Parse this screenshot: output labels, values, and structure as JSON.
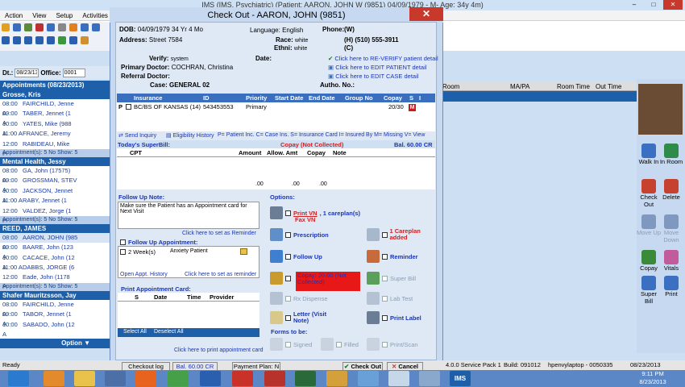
{
  "app": {
    "title": "IMS (IMS, Psychiatric)  (Patient: AARON, JOHN W (9851) 04/09/1979 - M- Age: 34y 4m)",
    "menu": [
      "Action",
      "View",
      "Setup",
      "Activities",
      "Bi"
    ],
    "window_controls": [
      "–",
      "□",
      "✕"
    ]
  },
  "left_panel": {
    "dt_label": "Dt.:",
    "date": "08/23/13",
    "office_label": "Office:",
    "office": "0001",
    "appointments_header": "Appointments (08/23/2013)",
    "providers": [
      {
        "name": "Grosse, Kris",
        "appointments": [
          {
            "time": "08:00 A",
            "patient": "FAIRCHILD, Jenne"
          },
          {
            "time": "09:00 A",
            "patient": "TABER, Jennet (1"
          },
          {
            "time": "10:00 A",
            "patient": "YATES, Mike (988"
          },
          {
            "time": "11:00 A",
            "patient": "FRANCE, Jeremy"
          },
          {
            "time": "12:00 P",
            "patient": "RABIDEAU, Mike"
          }
        ],
        "summary": "Appointment(s): 5  No Show: 5"
      },
      {
        "name": "Mental Health, Jessy",
        "appointments": [
          {
            "time": "08:00 A",
            "patient": "GA, John (17575)"
          },
          {
            "time": "09:00 A",
            "patient": "GROSSMAN, STEV"
          },
          {
            "time": "10:00 A",
            "patient": "JACKSON, Jennet"
          },
          {
            "time": "11:00 A",
            "patient": "RABY, Jennet (1"
          },
          {
            "time": "12:00 P",
            "patient": "VALDEZ, Jorge (1"
          }
        ],
        "summary": "Appointment(s): 5  No Show: 5"
      },
      {
        "name": "REED, JAMES",
        "appointments": [
          {
            "time": "08:00 A",
            "patient": "AARON, JOHN (985"
          },
          {
            "time": "09:00 A",
            "patient": "BAARE, John (123"
          },
          {
            "time": "10:00 A",
            "patient": "CACACE, John (12"
          },
          {
            "time": "11:00 A",
            "patient": "DABBS, JORGE (6"
          },
          {
            "time": "12:00 P",
            "patient": "Eade, John (1178"
          }
        ],
        "summary": "Appointment(s): 5  No Show: 5"
      },
      {
        "name": "Shafer Mauritzsson, Jay",
        "appointments": [
          {
            "time": "08:00 A",
            "patient": "FAIRCHILD, Jenne"
          },
          {
            "time": "09:00 A",
            "patient": "TABOR, Jennet (1"
          },
          {
            "time": "10:00 A",
            "patient": "SABADO, John (12"
          }
        ]
      }
    ],
    "option_label": "Option"
  },
  "background_grid": {
    "columns": [
      "Room",
      "MA/PA",
      "Room Time",
      "Out Time"
    ]
  },
  "right_panel": {
    "buttons": [
      {
        "label": "Walk In",
        "color": "#3b6fc1"
      },
      {
        "label": "In Room",
        "color": "#2e8b4a"
      },
      {
        "label": "Check Out",
        "color": "#c6422f"
      },
      {
        "label": "Delete",
        "color": "#c6422f"
      },
      {
        "label": "Move Up",
        "color": "#7e98c0"
      },
      {
        "label": "Move Down",
        "color": "#7e98c0"
      },
      {
        "label": "Copay",
        "color": "#3a8a3a"
      },
      {
        "label": "Vitals",
        "color": "#c25b9b"
      },
      {
        "label": "Super Bill",
        "color": "#3b6fc1"
      },
      {
        "label": "Print",
        "color": "#3b6fc1"
      }
    ]
  },
  "dialog": {
    "title": "Check Out - AARON, JOHN  (9851)",
    "patient": {
      "dob_label": "DOB:",
      "dob": "04/09/1979  34 Yr 4 Mo",
      "language_label": "Language:",
      "language": "English",
      "phone_label": "Phone:",
      "phone_w": "(W)",
      "phone_h_label": "(H)",
      "phone_h": "(510) 555-3911",
      "phone_c": "(C)",
      "address_label": "Address:",
      "address": "Street 7584",
      "race_label": "Race:",
      "race": "white",
      "ethni_label": "Ethni:",
      "ethni": "white",
      "verify_label": "Verify:",
      "verify": "system",
      "date_label": "Date:",
      "primary_doctor_label": "Primary Doctor:",
      "primary_doctor": "COCHRAN, Christina",
      "referral_doctor_label": "Referral Doctor:",
      "case_label": "Case:",
      "case": "GENERAL 02",
      "autho_label": "Autho. No.:",
      "link_reverify": "Click here to RE-VERIFY patient detail",
      "link_edit_patient": "Click here to EDIT PATIENT detail",
      "link_edit_case": "Click here to EDIT CASE detail"
    },
    "insurance": {
      "headers": [
        "Insurance",
        "ID",
        "Priority",
        "Start Date",
        "End Date",
        "Group No",
        "Copay",
        "S",
        "I"
      ],
      "row": {
        "p": "P",
        "insurance": "BC/BS OF KANSAS  (14)",
        "id": "543453553",
        "priority": "Primary",
        "copay": "20/30",
        "s": "M"
      },
      "send_inquiry": "Send Inquiry",
      "eligibility": "Eligibility History",
      "legend": "P= Patient Inc.  C= Case Ins.  S= Insurance Card   I= Insured By   M= Missing   V= View"
    },
    "superbill": {
      "label": "Today's SuperBill:",
      "copay_status": "Copay (Not Collected)",
      "balance": "Bal. 60.00 CR",
      "headers": [
        "CPT",
        "Amount",
        "Allow. Amt",
        "Copay",
        "Note"
      ],
      "totals": [
        ".00",
        ".00",
        ".00"
      ]
    },
    "followup": {
      "note_label": "Follow Up Note:",
      "note": "Make sure the Patient has an Appointment card for Next Visit",
      "reminder_link": "Click here to set as Reminder",
      "appt_label": "Follow Up Appointment:",
      "appt_count": "2",
      "appt_unit": "Week(s)",
      "appt_type": "Anxiety Patient",
      "open_history": "Open Appt. History",
      "reminder_link2": "Click here to set as reminder"
    },
    "print_card": {
      "label": "Print Appointment Card:",
      "headers": [
        "S",
        "Date",
        "Time",
        "Provider"
      ],
      "select_all": "Select All",
      "deselect_all": "Deselect All",
      "print_link": "Click here to print appointment card"
    },
    "options": {
      "label": "Options:",
      "print_vn": "Print VN",
      "careplan_count": ", 1 careplan(s)",
      "fax_vn": "Fax VN",
      "prescription": "Prescription",
      "careplan_added": "1 Careplan added",
      "follow_up": "Follow Up",
      "reminder": "Reminder",
      "copay": "Copay: 20.00 (Not Collected)",
      "super_bill": "Super Bill",
      "rx_dispense": "Rx Dispense",
      "lab_test": "Lab Test",
      "letter": "Letter (Visit Note)",
      "print_label": "Print Label",
      "forms_label": "Forms to be:",
      "signed": "Signed",
      "filled": "Filled",
      "print_scan": "Print/Scan"
    },
    "buttons": {
      "checkout_log": "Checkout log",
      "payment": "Payment Plan: N",
      "balance_short": "Bal. 60.00 CR",
      "checkout": "Check Out",
      "cancel": "Cancel"
    }
  },
  "status": {
    "ready": "Ready",
    "version": "4.0.0 Service Pack 1",
    "build": "Build: 091012",
    "machine": "hpenvylaptop - 0050335",
    "date": "08/23/2013"
  },
  "taskbar": {
    "time": "9:11 PM",
    "date": "8/23/2013",
    "ims": "IMS"
  }
}
